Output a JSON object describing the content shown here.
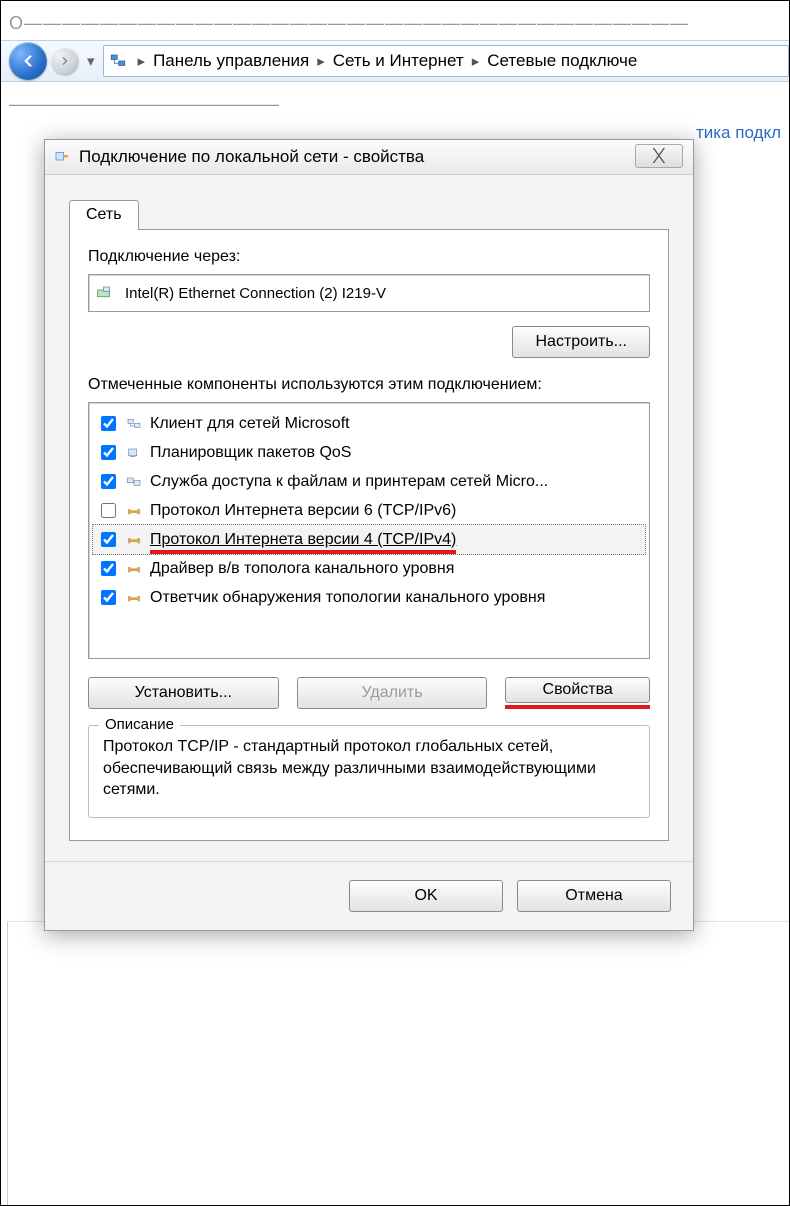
{
  "top_blur": "О———————————————————————————————————",
  "breadcrumb": {
    "level1": "Панель управления",
    "level2": "Сеть и Интернет",
    "level3": "Сетевые подключе"
  },
  "after_blur": "———————————————",
  "behind_right": "тика подкл",
  "dialog": {
    "title": "Подключение по локальной сети - свойства",
    "close_glyph": "✕",
    "tab": "Сеть",
    "connect_label": "Подключение через:",
    "adapter": "Intel(R) Ethernet Connection (2) I219-V",
    "configure": "Настроить...",
    "components_label": "Отмеченные компоненты используются этим подключением:",
    "items": [
      {
        "checked": true,
        "icon": "client",
        "label": "Клиент для сетей Microsoft"
      },
      {
        "checked": true,
        "icon": "qos",
        "label": "Планировщик пакетов QoS"
      },
      {
        "checked": true,
        "icon": "share",
        "label": "Служба доступа к файлам и принтерам сетей Micro..."
      },
      {
        "checked": false,
        "icon": "proto",
        "label": "Протокол Интернета версии 6 (TCP/IPv6)"
      },
      {
        "checked": true,
        "icon": "proto",
        "label": "Протокол Интернета версии 4 (TCP/IPv4)",
        "selected": true
      },
      {
        "checked": true,
        "icon": "proto",
        "label": "Драйвер в/в тополога канального уровня"
      },
      {
        "checked": true,
        "icon": "proto",
        "label": "Ответчик обнаружения топологии канального уровня"
      }
    ],
    "install": "Установить...",
    "uninstall": "Удалить",
    "properties": "Свойства",
    "desc_title": "Описание",
    "desc_text": "Протокол TCP/IP - стандартный протокол глобальных сетей, обеспечивающий связь между различными взаимодействующими сетями.",
    "ok": "OK",
    "cancel": "Отмена"
  }
}
